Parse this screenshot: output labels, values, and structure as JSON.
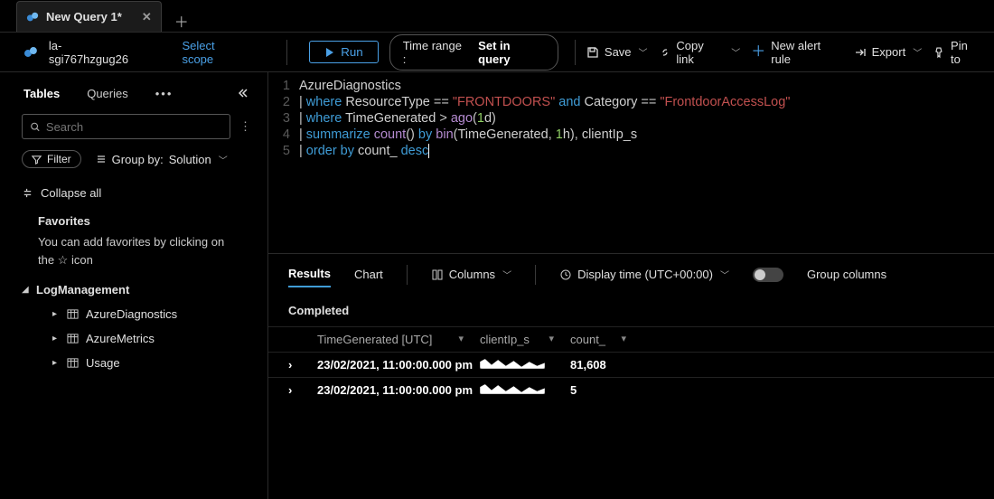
{
  "tab": {
    "title": "New Query 1*"
  },
  "workspace": {
    "name": "la-sgi767hzgug26",
    "select_scope": "Select scope"
  },
  "toolbar": {
    "run": "Run",
    "time_label": "Time range :",
    "time_value": "Set in query",
    "save": "Save",
    "copy_link": "Copy link",
    "new_alert": "New alert rule",
    "export": "Export",
    "pin": "Pin to"
  },
  "sidebar": {
    "tabs": {
      "tables": "Tables",
      "queries": "Queries"
    },
    "search_placeholder": "Search",
    "filter": "Filter",
    "group_by_label": "Group by:",
    "group_by_value": "Solution",
    "collapse_all": "Collapse all",
    "favorites_title": "Favorites",
    "favorites_hint": "You can add favorites by clicking on the ☆ icon",
    "section": "LogManagement",
    "items": [
      "AzureDiagnostics",
      "AzureMetrics",
      "Usage"
    ]
  },
  "editor": {
    "lines": [
      {
        "n": 1
      },
      {
        "n": 2
      },
      {
        "n": 3
      },
      {
        "n": 4
      },
      {
        "n": 5
      }
    ],
    "tokens": {
      "l1_id": "AzureDiagnostics",
      "l2_kw1": "where",
      "l2_id1": "ResourceType",
      "l2_op": " == ",
      "l2_str1": "\"FRONTDOORS\"",
      "l2_kw2": "and",
      "l2_id2": "Category",
      "l2_str2": "\"FrontdoorAccessLog\"",
      "l3_kw1": "where",
      "l3_id1": "TimeGenerated",
      "l3_op": " > ",
      "l3_fn": "ago",
      "l3_num": "1",
      "l3_unit": "d",
      "l4_kw1": "summarize",
      "l4_fn1": "count",
      "l4_kw2": "by",
      "l4_fn2": "bin",
      "l4_id1": "TimeGenerated",
      "l4_num": "1",
      "l4_unit": "h",
      "l4_id2": "clientIp_s",
      "l5_kw1": "order by",
      "l5_id": "count_",
      "l5_kw2": "desc"
    }
  },
  "results": {
    "tabs": {
      "results": "Results",
      "chart": "Chart"
    },
    "columns_btn": "Columns",
    "display_time": "Display time (UTC+00:00)",
    "group_cols": "Group columns",
    "status": "Completed",
    "headers": {
      "a": "TimeGenerated [UTC]",
      "b": "clientIp_s",
      "c": "count_"
    },
    "rows": [
      {
        "time": "23/02/2021, 11:00:00.000 pm",
        "ip": "█",
        "count": "81,608"
      },
      {
        "time": "23/02/2021, 11:00:00.000 pm",
        "ip": "█",
        "count": "5"
      }
    ]
  }
}
